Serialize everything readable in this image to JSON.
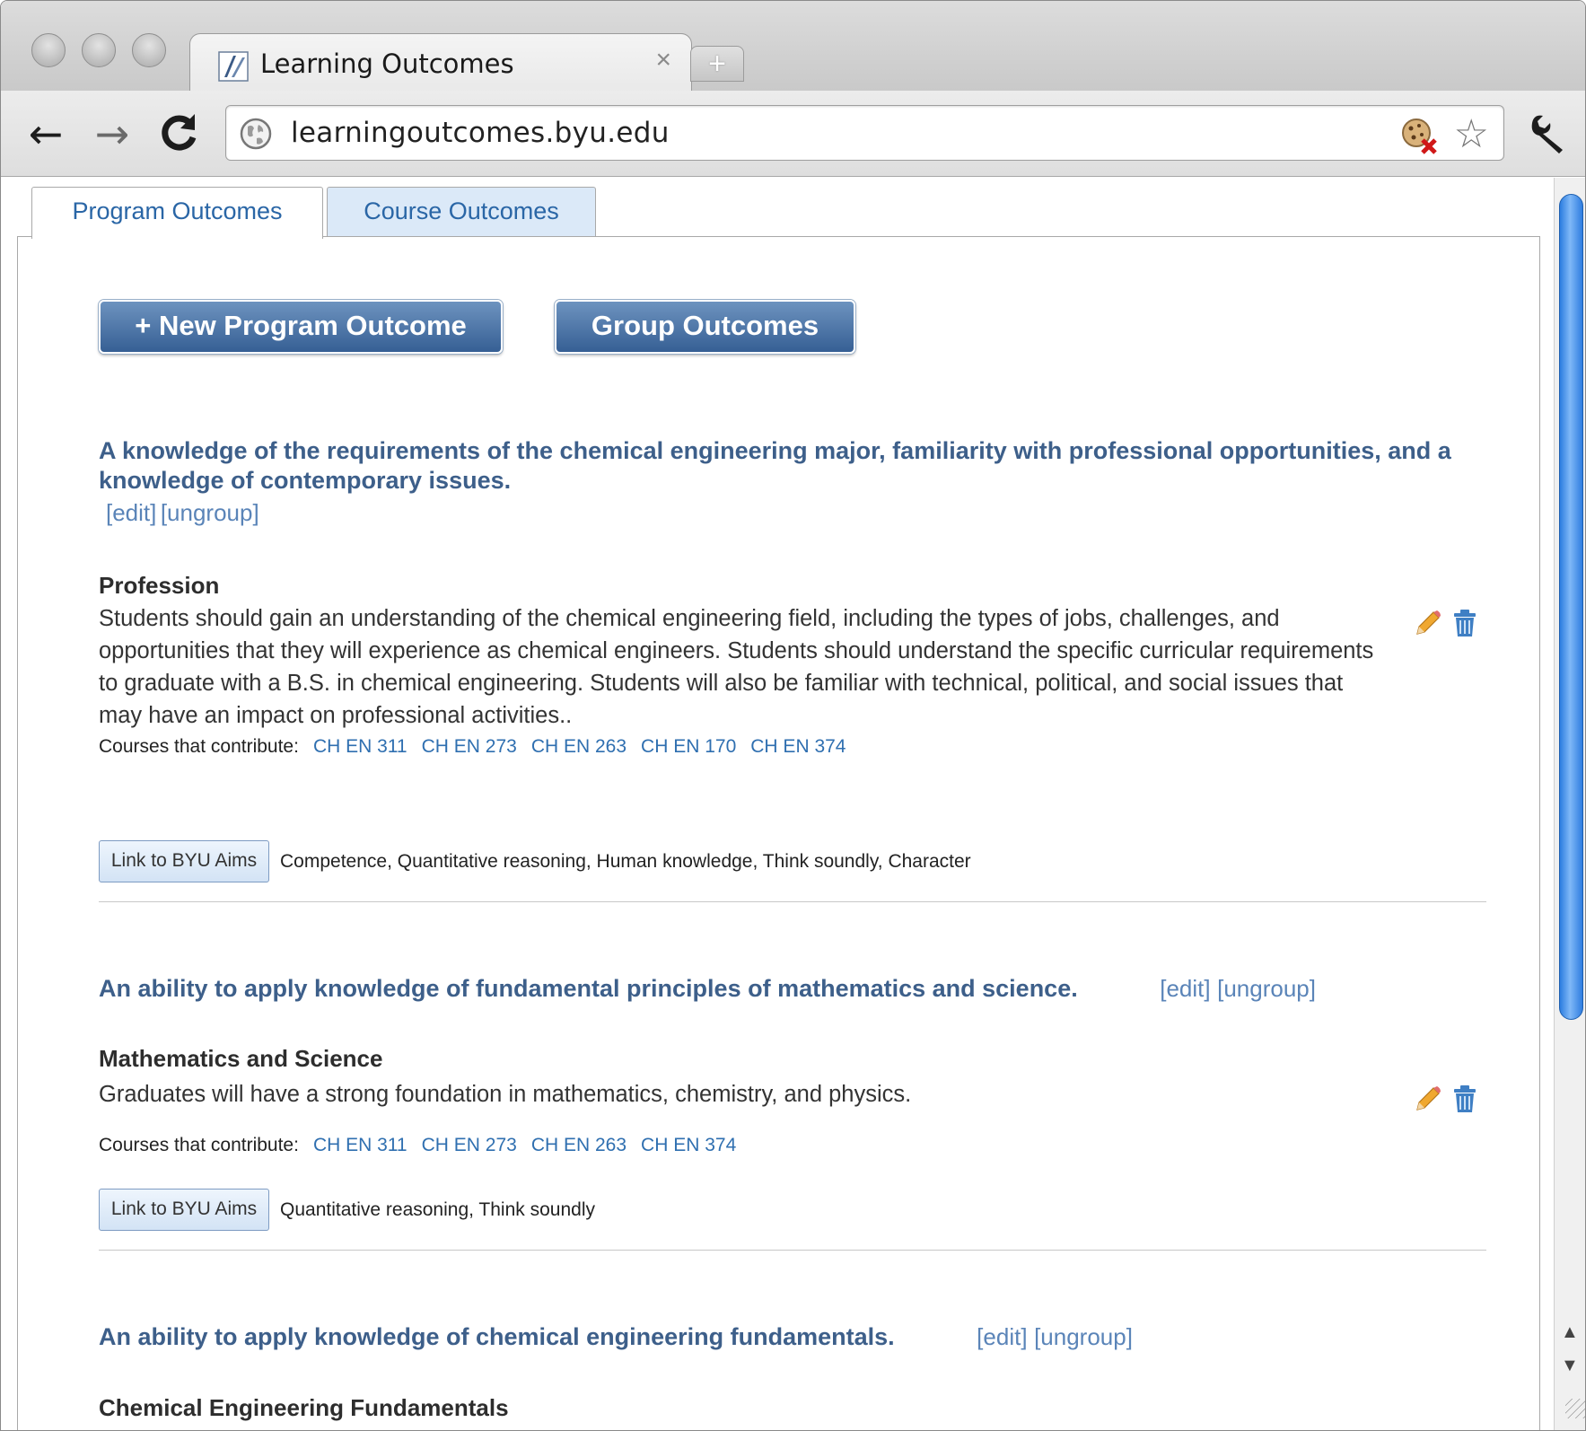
{
  "browser": {
    "tab_title": "Learning Outcomes",
    "tab_close": "×",
    "new_tab": "+",
    "url": "learningoutcomes.byu.edu",
    "nav": {
      "back": "←",
      "forward": "→",
      "reload": "C"
    },
    "star": "☆"
  },
  "page_tabs": {
    "program": "Program Outcomes",
    "course": "Course Outcomes"
  },
  "buttons": {
    "new_outcome": "+ New Program Outcome",
    "group_outcomes": "Group Outcomes"
  },
  "labels": {
    "edit": "[edit]",
    "ungroup": "[ungroup]",
    "courses_contribute": "Courses that contribute:",
    "link_aims": "Link to BYU Aims"
  },
  "groups": [
    {
      "title_line1": "A knowledge of the requirements of the chemical engineering major, familiarity with professional opportunities, and a",
      "title_line2": "knowledge of contemporary issues.",
      "outcome": {
        "title": "Profession",
        "desc_lines": [
          "Students should gain an understanding of the chemical engineering field, including the types of jobs, challenges, and",
          "opportunities that they will experience as chemical engineers. Students should understand the specific curricular requirements",
          "to graduate with a B.S. in chemical engineering. Students will also be familiar with technical, political, and social issues that",
          "may have an impact on professional activities.."
        ],
        "courses": [
          "CH EN 311",
          "CH EN 273",
          "CH EN 263",
          "CH EN 170",
          "CH EN 374"
        ],
        "aims": "Competence, Quantitative reasoning, Human knowledge, Think soundly, Character"
      }
    },
    {
      "title": "An ability to apply knowledge of fundamental principles of mathematics and science.",
      "outcome": {
        "title": "Mathematics and Science",
        "desc": "Graduates will have a strong foundation in mathematics, chemistry, and physics.",
        "courses": [
          "CH EN 311",
          "CH EN 273",
          "CH EN 263",
          "CH EN 374"
        ],
        "aims": "Quantitative reasoning, Think soundly"
      }
    },
    {
      "title": "An ability to apply knowledge of chemical engineering fundamentals.",
      "outcome": {
        "title": "Chemical Engineering Fundamentals"
      }
    }
  ],
  "colors": {
    "accent": "#3d5f8a",
    "link": "#2f6fb0",
    "button": "#4a72a3",
    "scroll_thumb": "#2c7de0"
  }
}
